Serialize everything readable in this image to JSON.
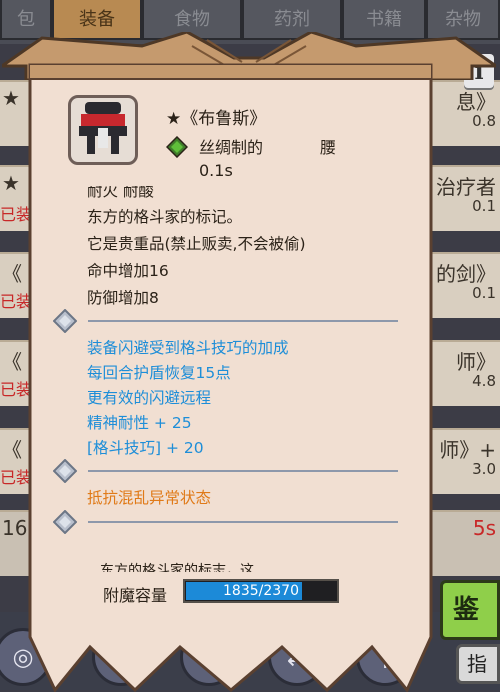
{
  "tabs": [
    {
      "label": "包"
    },
    {
      "label": "装备"
    },
    {
      "label": "食物"
    },
    {
      "label": "药剂"
    },
    {
      "label": "书籍"
    },
    {
      "label": "杂物"
    }
  ],
  "info_label": "i",
  "background_rows": [
    {
      "left": "★",
      "right": "息》",
      "sub": "0.8",
      "red": ""
    },
    {
      "left": "★",
      "right": "治疗者",
      "sub": "0.1",
      "red": "已装"
    },
    {
      "left": "《",
      "right": "的剑》",
      "sub": "0.1",
      "red": "已装"
    },
    {
      "left": "《",
      "right": "师》",
      "sub": "4.8",
      "red": "已装"
    },
    {
      "left": "《",
      "right": "师》+",
      "sub": "3.0",
      "red": "已装"
    },
    {
      "left": "16",
      "right": "5s",
      "sub": "",
      "red": ""
    }
  ],
  "right_buttons": {
    "green": "鉴",
    "grey": "指"
  },
  "bottom_icons": [
    "◎",
    "✲",
    "♞",
    "⇄",
    "⚲"
  ],
  "item": {
    "star": "★",
    "name": "《布鲁斯》",
    "material": "丝绸制的",
    "slot": "腰",
    "weight": "0.1s",
    "cutoff_text": "耐火 耐酸",
    "lines_dark": [
      "东方的格斗家的标记。",
      "它是贵重品(禁止贩卖,不会被偷)",
      "命中增加16",
      "防御增加8"
    ],
    "lines_blue": [
      "装备闪避受到格斗技巧的加成",
      "每回合护盾恢复15点",
      "更有效的闪避远程",
      "精神耐性 + 25",
      "[格斗技巧] + 20"
    ],
    "lines_orange": [
      "抵抗混乱异常状态"
    ],
    "description": "东方的格斗家的标志，这",
    "capacity_label": "附魔容量",
    "capacity_text": "1835/2370",
    "capacity_fraction": 0.774
  },
  "colors": {
    "blue_text": "#1e8ed8",
    "orange_text": "#e07a18",
    "panel": "#f1dfd2",
    "gem": "#5fbf3a"
  }
}
